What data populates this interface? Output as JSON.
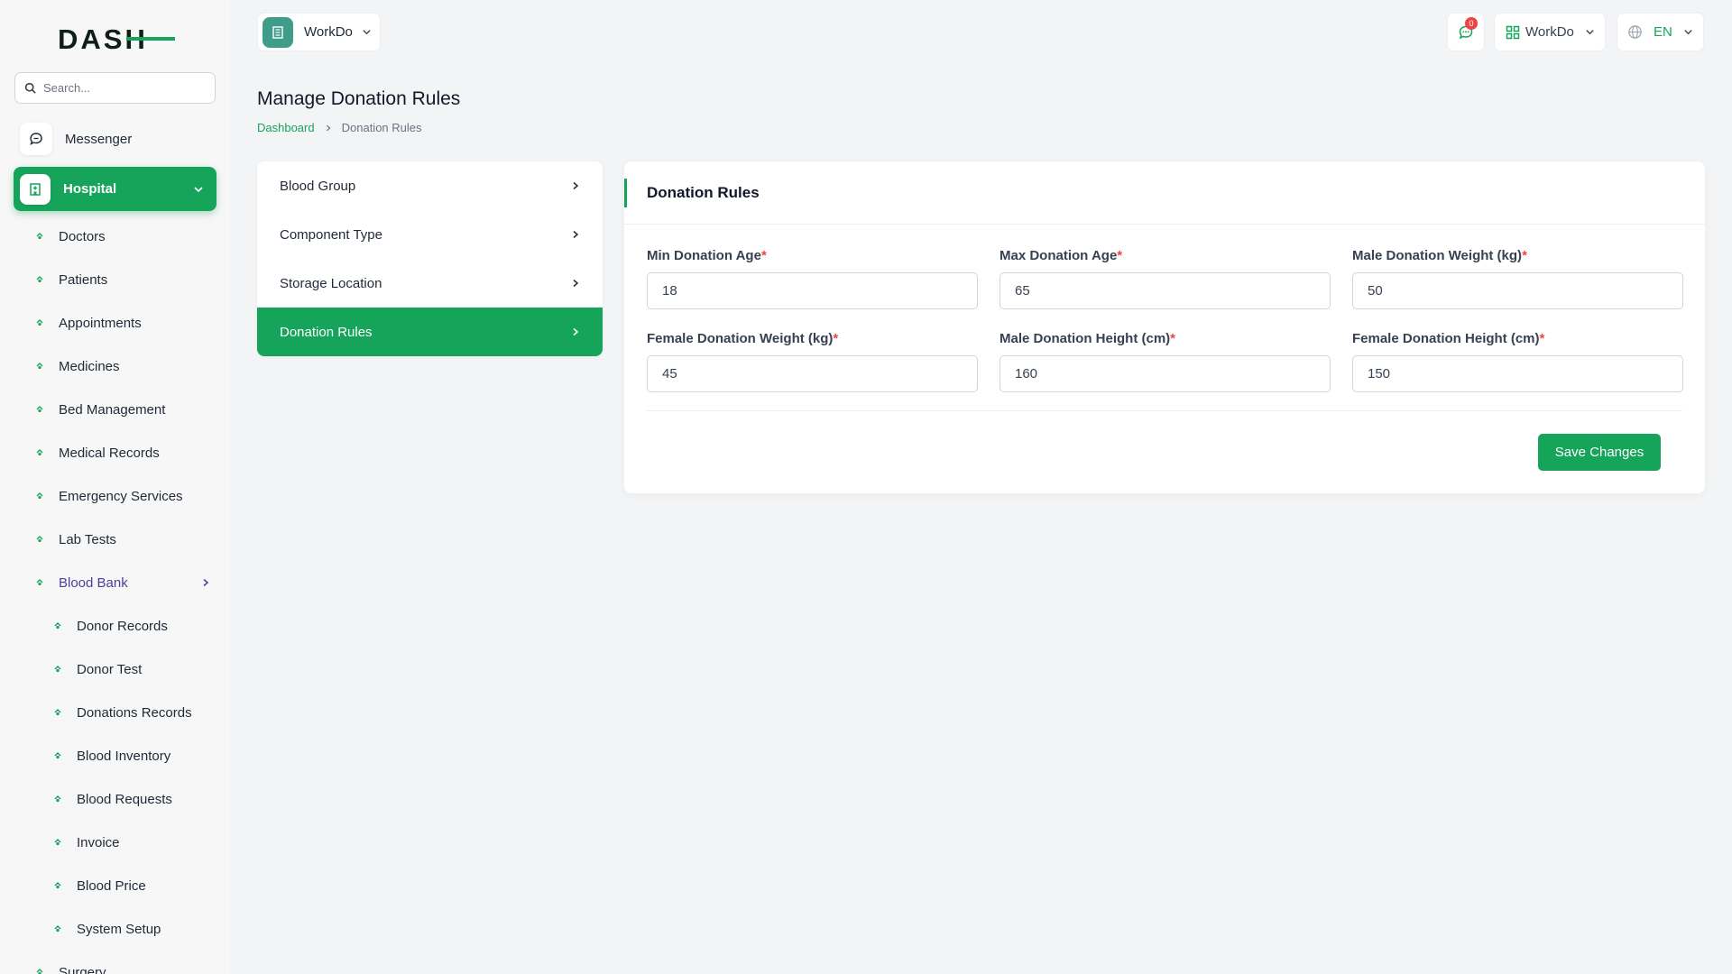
{
  "sidebar": {
    "logo_text": "DASH",
    "search_placeholder": "Search...",
    "messenger_label": "Messenger",
    "hospital_label": "Hospital",
    "items": [
      {
        "label": "Doctors"
      },
      {
        "label": "Patients"
      },
      {
        "label": "Appointments"
      },
      {
        "label": "Medicines"
      },
      {
        "label": "Bed Management"
      },
      {
        "label": "Medical Records"
      },
      {
        "label": "Emergency Services"
      },
      {
        "label": "Lab Tests"
      },
      {
        "label": "Blood Bank"
      }
    ],
    "blood_bank_items": [
      {
        "label": "Donor Records"
      },
      {
        "label": "Donor Test"
      },
      {
        "label": "Donations Records"
      },
      {
        "label": "Blood Inventory"
      },
      {
        "label": "Blood Requests"
      },
      {
        "label": "Invoice"
      },
      {
        "label": "Blood Price"
      },
      {
        "label": "System Setup"
      }
    ],
    "after_items": [
      {
        "label": "Surgery"
      }
    ]
  },
  "header": {
    "workspace_label": "WorkDo",
    "notification_count": "0",
    "company_label": "WorkDo",
    "language_label": "EN"
  },
  "page": {
    "title": "Manage Donation Rules",
    "breadcrumb": {
      "home": "Dashboard",
      "current": "Donation Rules"
    }
  },
  "settings_menu": [
    {
      "label": "Blood Group"
    },
    {
      "label": "Component Type"
    },
    {
      "label": "Storage Location"
    },
    {
      "label": "Donation Rules"
    }
  ],
  "form": {
    "title": "Donation Rules",
    "required_mark": "*",
    "fields": [
      {
        "label": "Min Donation Age",
        "value": "18"
      },
      {
        "label": "Max Donation Age",
        "value": "65"
      },
      {
        "label": "Male Donation Weight (kg)",
        "value": "50"
      },
      {
        "label": "Female Donation Weight (kg)",
        "value": "45"
      },
      {
        "label": "Male Donation Height (cm)",
        "value": "160"
      },
      {
        "label": "Female Donation Height (cm)",
        "value": "150"
      }
    ],
    "save_label": "Save Changes"
  },
  "colors": {
    "accent": "#16a35a",
    "active_sub_item": "#4b3f9a",
    "required": "#ef4444"
  }
}
